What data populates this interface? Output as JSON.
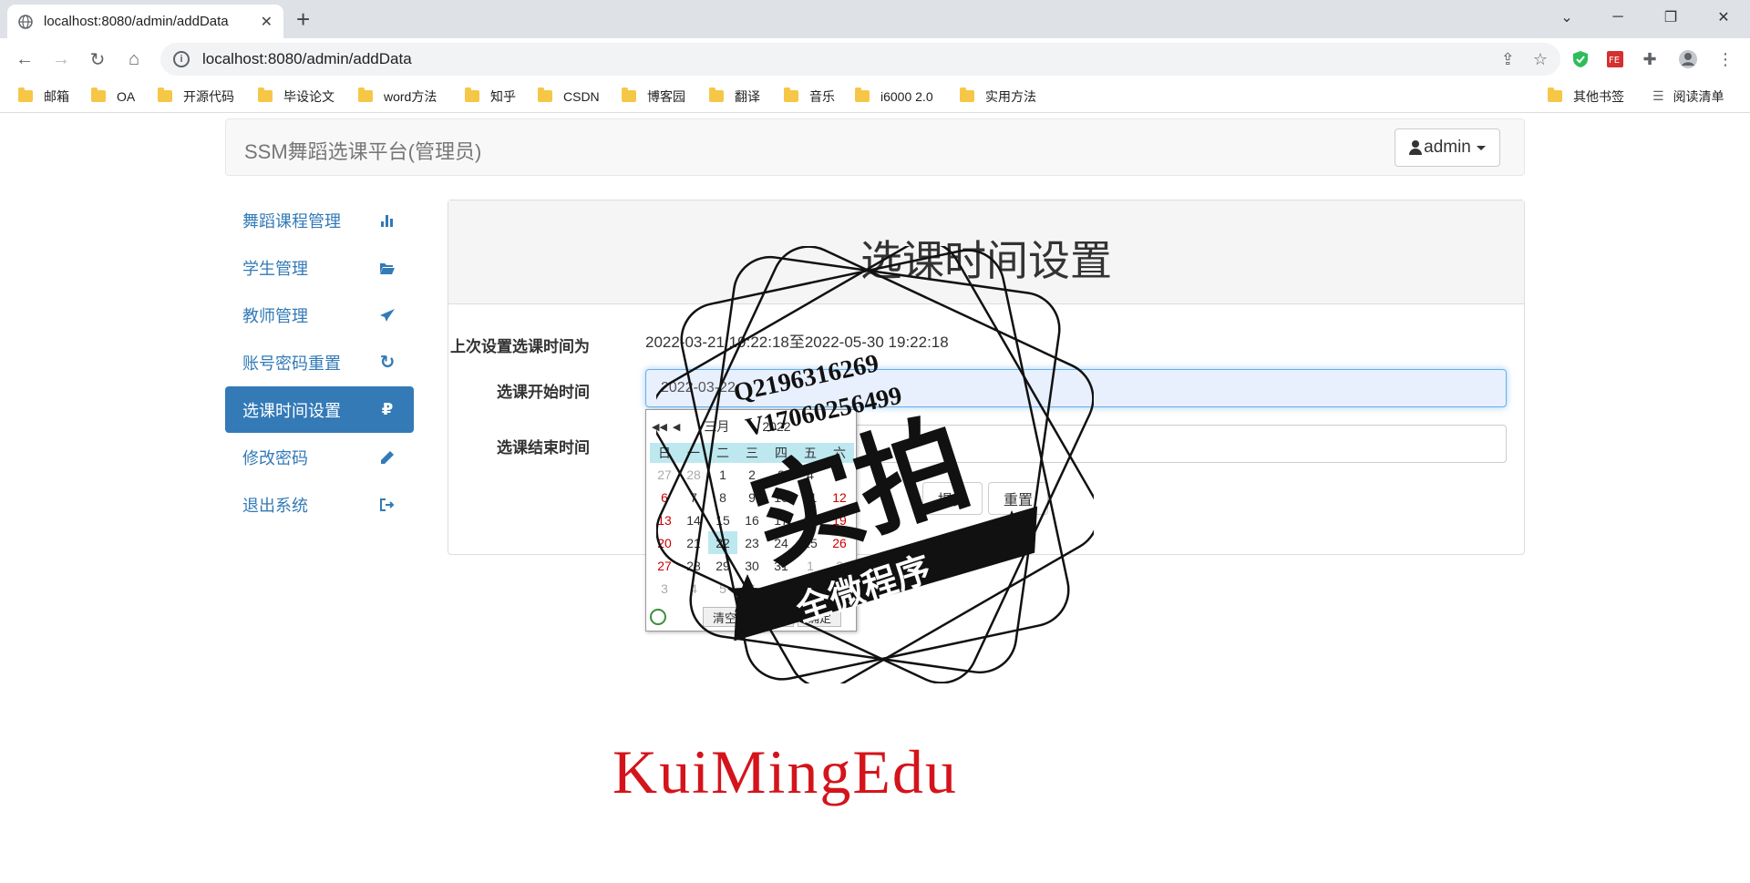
{
  "browser": {
    "tab_title": "localhost:8080/admin/addData",
    "url": "localhost:8080/admin/addData",
    "bookmarks": [
      "邮箱",
      "OA",
      "开源代码",
      "毕设论文",
      "word方法",
      "知乎",
      "CSDN",
      "博客园",
      "翻译",
      "音乐",
      "i6000 2.0",
      "实用方法"
    ],
    "other_bookmarks": "其他书签",
    "reading_list": "阅读清单"
  },
  "navbar": {
    "brand": "SSM舞蹈选课平台(管理员)",
    "user": "admin"
  },
  "sidebar": {
    "items": [
      {
        "label": "舞蹈课程管理",
        "icon": "bar-chart-icon"
      },
      {
        "label": "学生管理",
        "icon": "folder-open-icon"
      },
      {
        "label": "教师管理",
        "icon": "send-icon"
      },
      {
        "label": "账号密码重置",
        "icon": "refresh-icon"
      },
      {
        "label": "选课时间设置",
        "icon": "ruble-icon",
        "active": true
      },
      {
        "label": "修改密码",
        "icon": "pencil-icon"
      },
      {
        "label": "退出系统",
        "icon": "sign-out-icon"
      }
    ]
  },
  "form": {
    "title": "选课时间设置",
    "last_label": "上次设置选课时间为",
    "last_value": "2022-03-21 19:22:18至2022-05-30 19:22:18",
    "start_label": "选课开始时间",
    "start_value": "2022-03-22",
    "end_label": "选课结束时间",
    "end_value": "",
    "submit": "提交",
    "reset": "重置"
  },
  "datepicker": {
    "month": "三月",
    "year": "2022",
    "weekdays": [
      "日",
      "一",
      "二",
      "三",
      "四",
      "五",
      "六"
    ],
    "rows": [
      [
        "27",
        "28",
        "1",
        "2",
        "3",
        "4",
        "5"
      ],
      [
        "6",
        "7",
        "8",
        "9",
        "10",
        "11",
        "12"
      ],
      [
        "13",
        "14",
        "15",
        "16",
        "17",
        "18",
        "19"
      ],
      [
        "20",
        "21",
        "22",
        "23",
        "24",
        "25",
        "26"
      ],
      [
        "27",
        "28",
        "29",
        "30",
        "31",
        "1",
        "2"
      ],
      [
        "3",
        "4",
        "5",
        "6",
        "7",
        "8",
        "9"
      ]
    ],
    "clear": "清空",
    "today": "今天",
    "ok": "确定"
  },
  "stamp": {
    "line1": "Q2196316269",
    "line2": "V17060256499",
    "big": "实拍",
    "banner": "全微程序"
  },
  "watermark": "KuiMingEdu",
  "colors": {
    "primary": "#337ab7",
    "watermark": "#d4141b",
    "calendar_head": "#bde8ef"
  }
}
